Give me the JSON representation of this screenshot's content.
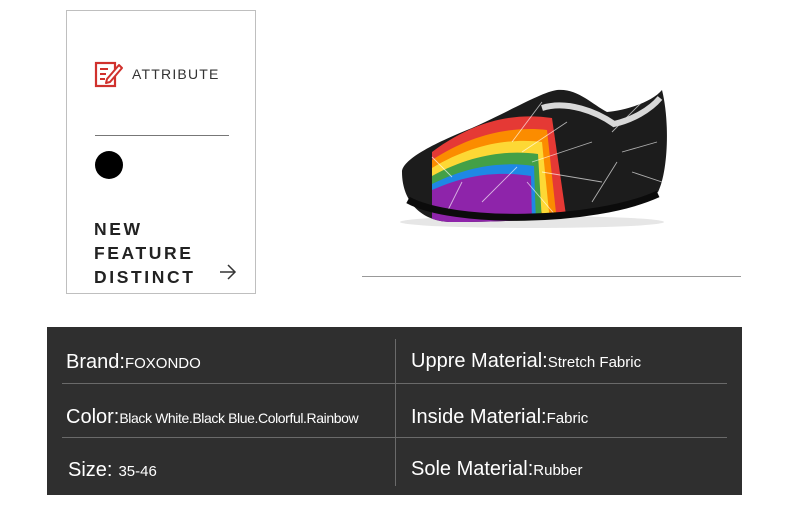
{
  "attribute_card": {
    "title": "ATTRIBUTE",
    "icon": "edit-document-icon",
    "tagline": [
      "NEW",
      "FEATURE",
      "DISTINCT"
    ],
    "arrow_icon": "arrow-right-icon"
  },
  "product": {
    "image": "rainbow-water-shoe",
    "colors": {
      "body": "#1c1c1c",
      "sole": "#111111"
    }
  },
  "specs": {
    "brand": {
      "label": "Brand: ",
      "value": "FOXONDO"
    },
    "upper_material": {
      "label": "Uppre Material: ",
      "value": "Stretch Fabric"
    },
    "color": {
      "label": "Color:",
      "value": "Black White.Black Blue.Colorful.Rainbow"
    },
    "inside_material": {
      "label": "Inside Material: ",
      "value": "Fabric"
    },
    "size": {
      "label": "Size: ",
      "value": "35-46"
    },
    "sole_material": {
      "label": "Sole Material: ",
      "value": "Rubber"
    }
  },
  "theme": {
    "panel_bg": "#2f2f2f",
    "icon_red": "#d0312d",
    "text_dark": "#222222"
  }
}
